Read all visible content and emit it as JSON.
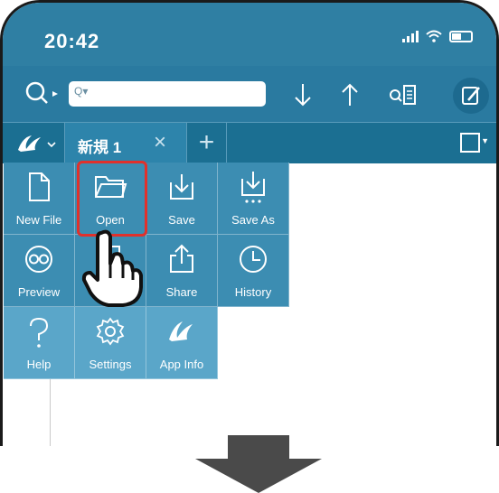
{
  "status_bar": {
    "time": "20:42"
  },
  "toolbar": {
    "search_placeholder": ""
  },
  "tabs": {
    "active_label": "新規 1",
    "close_symbol": "×",
    "add_symbol": "+"
  },
  "menu": {
    "rows": [
      [
        {
          "label": "New File",
          "icon": "new-file-icon"
        },
        {
          "label": "Open",
          "icon": "folder-open-icon"
        },
        {
          "label": "Save",
          "icon": "save-icon"
        },
        {
          "label": "Save As",
          "icon": "save-as-icon"
        }
      ],
      [
        {
          "label": "Preview",
          "icon": "preview-icon"
        },
        {
          "label": "Fi",
          "icon": "files-icon"
        },
        {
          "label": "Share",
          "icon": "share-icon"
        },
        {
          "label": "History",
          "icon": "history-icon"
        }
      ],
      [
        {
          "label": "Help",
          "icon": "help-icon"
        },
        {
          "label": "Settings",
          "icon": "settings-icon"
        },
        {
          "label": "App Info",
          "icon": "app-info-icon"
        }
      ]
    ],
    "highlighted_item": "Open"
  },
  "colors": {
    "toolbar": "#2a7aa0",
    "tab_bar": "#1b6f92",
    "menu": "#3c8db2",
    "menu_light": "#5aa6c9",
    "highlight": "#e0312c",
    "arrow": "#4a4a4a"
  }
}
